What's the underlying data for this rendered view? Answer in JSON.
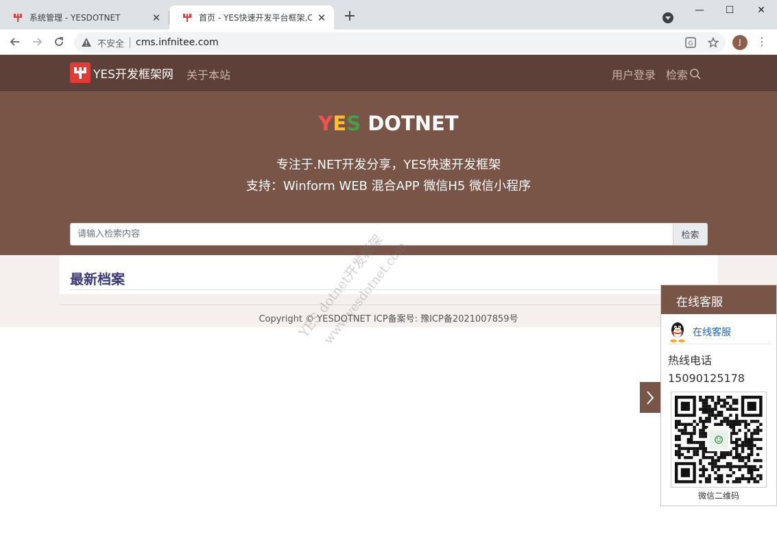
{
  "browser": {
    "tabs": [
      {
        "title": "系统管理 - YESDOTNET",
        "active": false
      },
      {
        "title": "首页 - YES快速开发平台框架,C#",
        "active": true
      }
    ],
    "new_tab": "+",
    "address": {
      "security_label": "不安全",
      "url": "cms.infnitee.com"
    },
    "profile_initial": "J",
    "window_controls": {
      "minimize": "—",
      "maximize": "☐",
      "close": "✕"
    }
  },
  "site": {
    "brand": "YES开发框架网",
    "nav": {
      "about": "关于本站",
      "login": "用户登录",
      "search": "检索"
    },
    "hero": {
      "logo": {
        "y": "Y",
        "e": "E",
        "s": "S",
        "rest": "DOTNET"
      },
      "tagline": "专注于.NET开发分享，YES快速开发框架",
      "support": "支持：Winform WEB 混合APP 微信H5 微信小程序"
    },
    "search": {
      "placeholder": "请输入检索内容",
      "button": "检索"
    },
    "section_title": "最新档案",
    "footer": {
      "copyright": "Copyright © YESDOTNET ICP备案号: 豫ICP备2021007859号"
    },
    "watermark": {
      "line1": "YES dotnet开发框架",
      "line2": "www.yesdotnet.com"
    }
  },
  "service_panel": {
    "title": "在线客服",
    "qq_link": "在线客服",
    "hotline_label": "热线电话",
    "hotline_number": "15090125178",
    "qr_caption": "微信二维码"
  },
  "colors": {
    "nav_bg": "#5d4037",
    "hero_bg": "#795548",
    "section_title": "#3c3a7a",
    "logo_y": "#ef5350",
    "logo_e": "#fbc02d",
    "logo_s": "#43a047"
  }
}
